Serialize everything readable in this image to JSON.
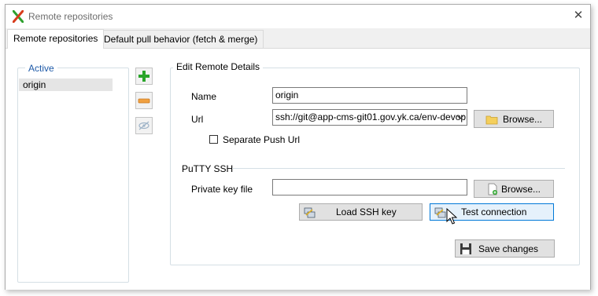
{
  "window": {
    "title": "Remote repositories",
    "app_icon": "git-extensions-x-icon",
    "close_icon": "close-icon"
  },
  "tabs": [
    {
      "label": "Remote repositories",
      "active": true
    },
    {
      "label": "Default pull behavior (fetch & merge)",
      "active": false
    }
  ],
  "remotes_list": {
    "legend": "Active",
    "items": [
      {
        "name": "origin",
        "selected": true
      }
    ]
  },
  "side_buttons": {
    "add": "add-remote-icon",
    "remove": "remove-remote-icon",
    "toggle": "disable-remote-icon"
  },
  "edit": {
    "legend": "Edit Remote Details",
    "name_label": "Name",
    "name_value": "origin",
    "url_label": "Url",
    "url_value": "ssh://git@app-cms-git01.gov.yk.ca/env-devop",
    "browse_label": "Browse...",
    "separate_push_label": "Separate Push Url",
    "separate_push_checked": false
  },
  "putty": {
    "heading": "PuTTY SSH",
    "key_label": "Private key file",
    "key_value": "",
    "browse_label": "Browse...",
    "load_key_label": "Load SSH key",
    "test_label": "Test connection"
  },
  "save_label": "Save changes",
  "colors": {
    "accent": "#0078d7",
    "add_green": "#2aa52a",
    "remove_orange": "#f0a040"
  }
}
